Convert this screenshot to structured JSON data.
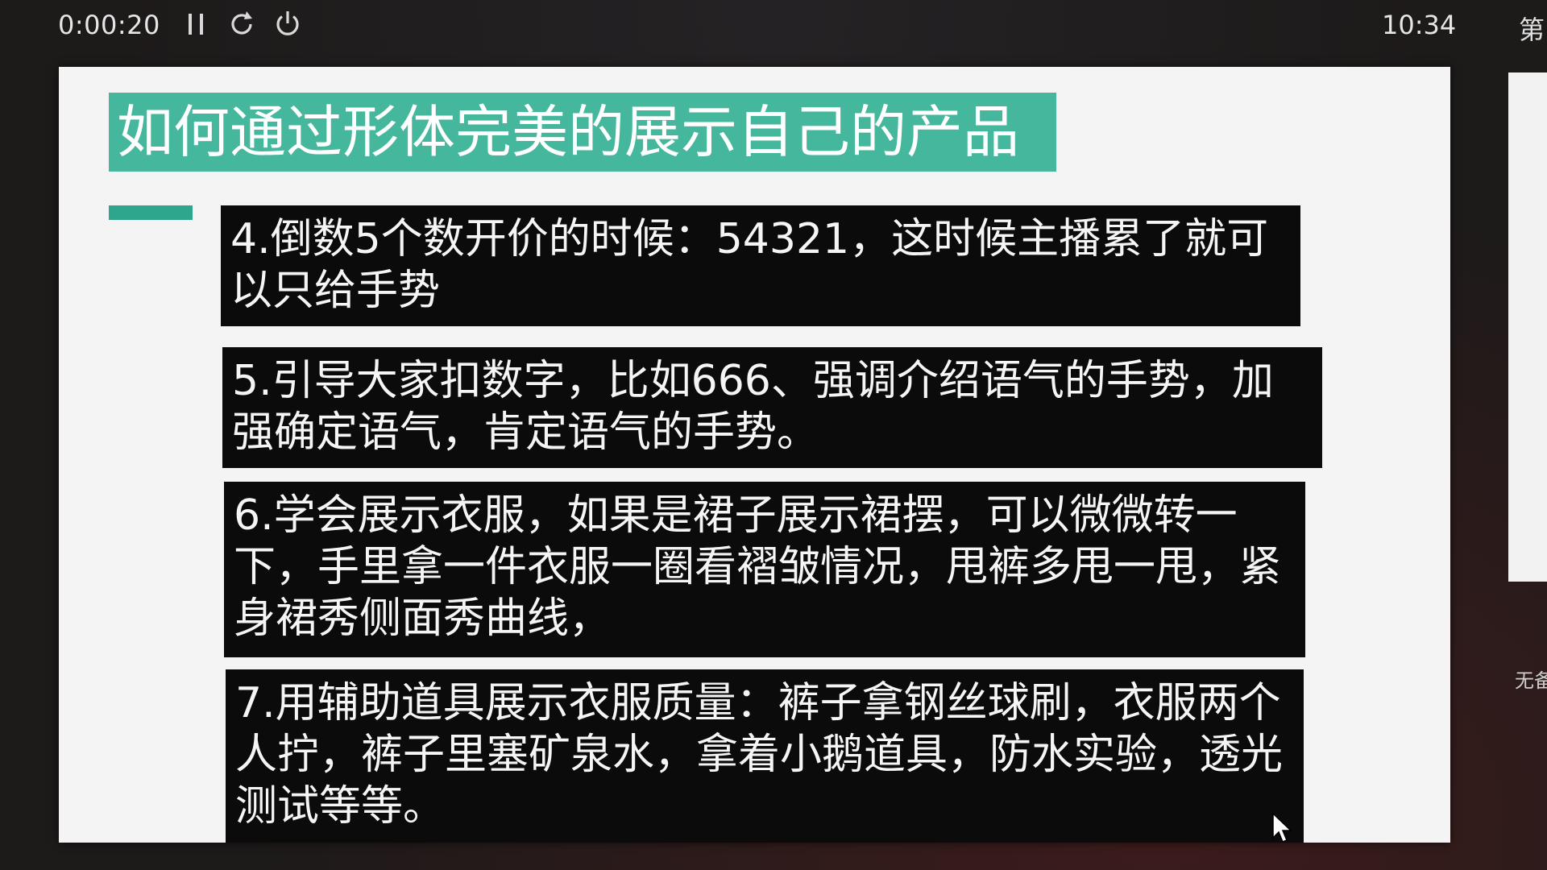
{
  "toolbar": {
    "timer": "0:00:20",
    "clock": "10:34",
    "icons": [
      "pause-icon",
      "restart-icon",
      "power-icon"
    ],
    "edge_label_top": "第",
    "edge_label_bottom": "无备"
  },
  "slide": {
    "title": "如何通过形体完美的展示自己的产品",
    "colors": {
      "title_bg": "#45b79c",
      "accent": "#2ea58d",
      "point_bg": "#0c0b0b",
      "point_text": "#f5f5f5"
    },
    "points": [
      "4.倒数5个数开价的时候：54321，这时候主播累了就可以只给手势",
      "5.引导大家扣数字，比如666、强调介绍语气的手势，加强确定语气，肯定语气的手势。",
      "6.学会展示衣服，如果是裙子展示裙摆，可以微微转一下，手里拿一件衣服一圈看褶皱情况，甩裤多甩一甩，紧身裙秀侧面秀曲线，",
      "7.用辅助道具展示衣服质量：裤子拿钢丝球刷，衣服两个人拧，裤子里塞矿泉水，拿着小鹅道具，防水实验，透光测试等等。"
    ]
  }
}
